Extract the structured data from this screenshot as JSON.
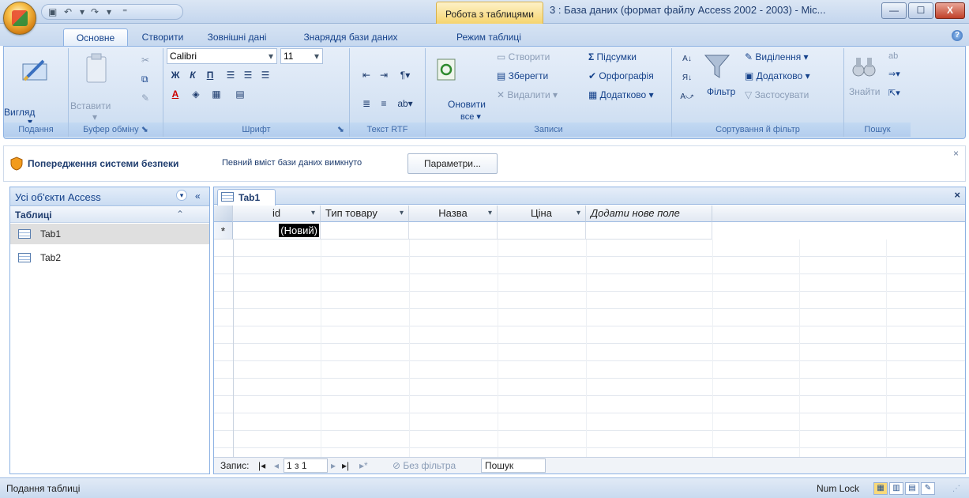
{
  "window": {
    "title": "3 : База даних (формат файлу Access 2002 - 2003) - Mic...",
    "context_tab": "Робота з таблицями",
    "min_label": "—",
    "max_label": "☐",
    "close_label": "X"
  },
  "tabs": [
    "Основне",
    "Створити",
    "Зовнішні дані",
    "Знаряддя бази даних",
    "Режим таблиці"
  ],
  "ribbon": {
    "view_group": {
      "button": "Вигляд",
      "label": "Подання"
    },
    "clipboard_group": {
      "paste": "Вставити",
      "label": "Буфер обміну"
    },
    "font_group": {
      "font_name": "Calibri",
      "font_size": "11",
      "bold": "Ж",
      "italic": "К",
      "underline": "П",
      "label": "Шрифт"
    },
    "rtf_group": {
      "label": "Текст RTF"
    },
    "records_group": {
      "refresh": "Оновити",
      "refresh_all": "все",
      "new": "Створити",
      "save": "Зберегти",
      "delete": "Видалити",
      "totals": "Підсумки",
      "spelling": "Орфографія",
      "more": "Додатково",
      "label": "Записи"
    },
    "sort_group": {
      "filter": "Фільтр",
      "selection": "Виділення",
      "advanced": "Додатково",
      "apply": "Застосувати",
      "label": "Сортування й фільтр"
    },
    "find_group": {
      "find": "Знайти",
      "label": "Пошук"
    }
  },
  "security": {
    "title": "Попередження системи безпеки",
    "message": "Певний вміст бази даних вимкнуто",
    "button": "Параметри..."
  },
  "nav": {
    "header": "Усі об'єкти Access",
    "group": "Таблиці",
    "items": [
      {
        "label": "Tab1"
      },
      {
        "label": "Tab2"
      }
    ]
  },
  "document": {
    "tab": "Tab1",
    "columns": [
      "id",
      "Тип товару",
      "Назва",
      "Ціна",
      "Додати нове поле"
    ],
    "new_row_marker": "*",
    "new_row_value": "(Новий)"
  },
  "record_nav": {
    "label": "Запис:",
    "position": "1 з 1",
    "filter": "Без фільтра",
    "search": "Пошук"
  },
  "status": {
    "left": "Подання таблиці",
    "numlock": "Num Lock"
  }
}
